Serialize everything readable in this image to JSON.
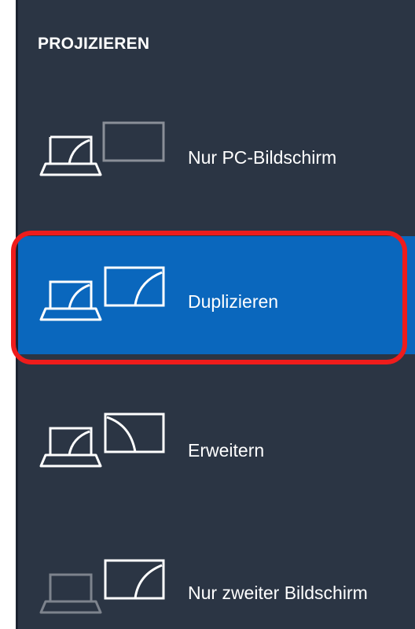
{
  "panel": {
    "title": "PROJIZIEREN",
    "background": "#2b3544",
    "selected_color": "#0a67bd",
    "highlight_color": "#ee1c1c"
  },
  "options": [
    {
      "label": "Nur PC-Bildschirm",
      "icon": "pc-screen-only-icon",
      "selected": false
    },
    {
      "label": "Duplizieren",
      "icon": "duplicate-icon",
      "selected": true
    },
    {
      "label": "Erweitern",
      "icon": "extend-icon",
      "selected": false
    },
    {
      "label": "Nur zweiter Bildschirm",
      "icon": "second-screen-only-icon",
      "selected": false
    }
  ]
}
